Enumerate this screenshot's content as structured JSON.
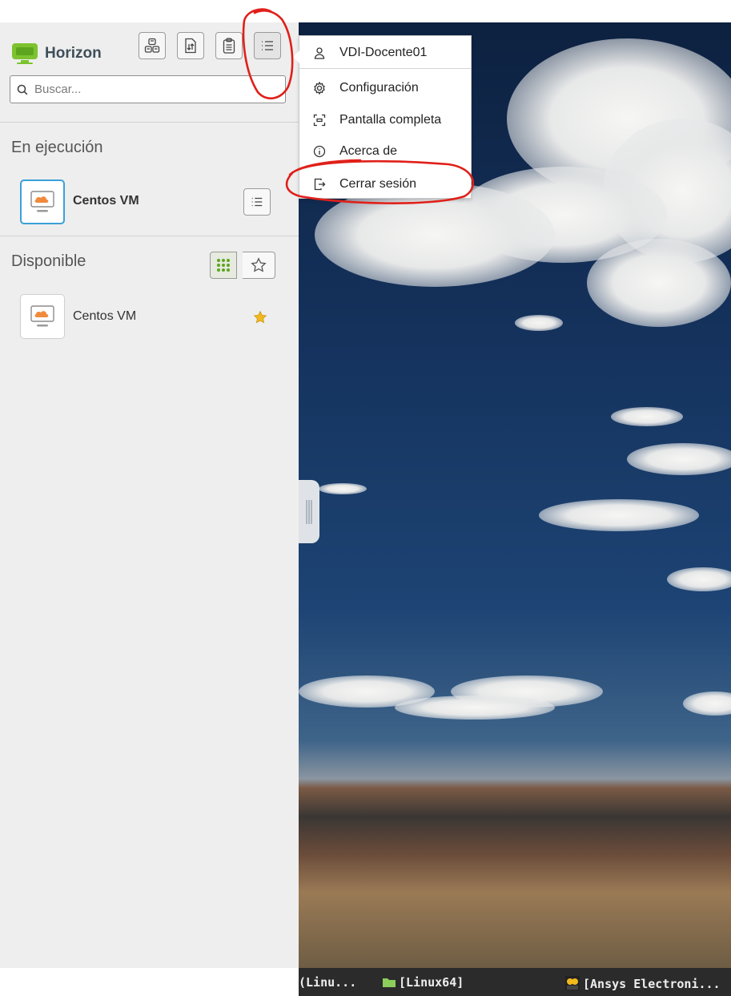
{
  "app": {
    "title": "Horizon"
  },
  "toolbar": {
    "buttons": [
      {
        "icon": "usb-devices-icon"
      },
      {
        "icon": "file-transfer-icon"
      },
      {
        "icon": "clipboard-icon"
      },
      {
        "icon": "menu-icon"
      }
    ]
  },
  "search": {
    "placeholder": "Buscar..."
  },
  "running": {
    "heading": "En ejecución",
    "items": [
      {
        "name": "Centos VM"
      }
    ]
  },
  "available": {
    "heading": "Disponible",
    "items": [
      {
        "name": "Centos VM",
        "favorite": true
      }
    ]
  },
  "menu": {
    "user": "VDI-Docente01",
    "items": [
      {
        "label": "Configuración",
        "icon": "gear-icon"
      },
      {
        "label": "Pantalla completa",
        "icon": "fullscreen-icon"
      },
      {
        "label": "Acerca de",
        "icon": "info-icon"
      },
      {
        "label": "Cerrar sesión",
        "icon": "logout-icon"
      }
    ]
  },
  "taskbar": {
    "items": [
      {
        "label": "(Linu..."
      },
      {
        "label": "[Linux64]"
      },
      {
        "label": "[Ansys Electroni..."
      }
    ]
  },
  "colors": {
    "accent": "#3ba0d8",
    "logo_green": "#7cc32f",
    "vm_orange": "#f08a3c",
    "annotation_red": "#e0201a",
    "favorite_star": "#f2b91c"
  }
}
